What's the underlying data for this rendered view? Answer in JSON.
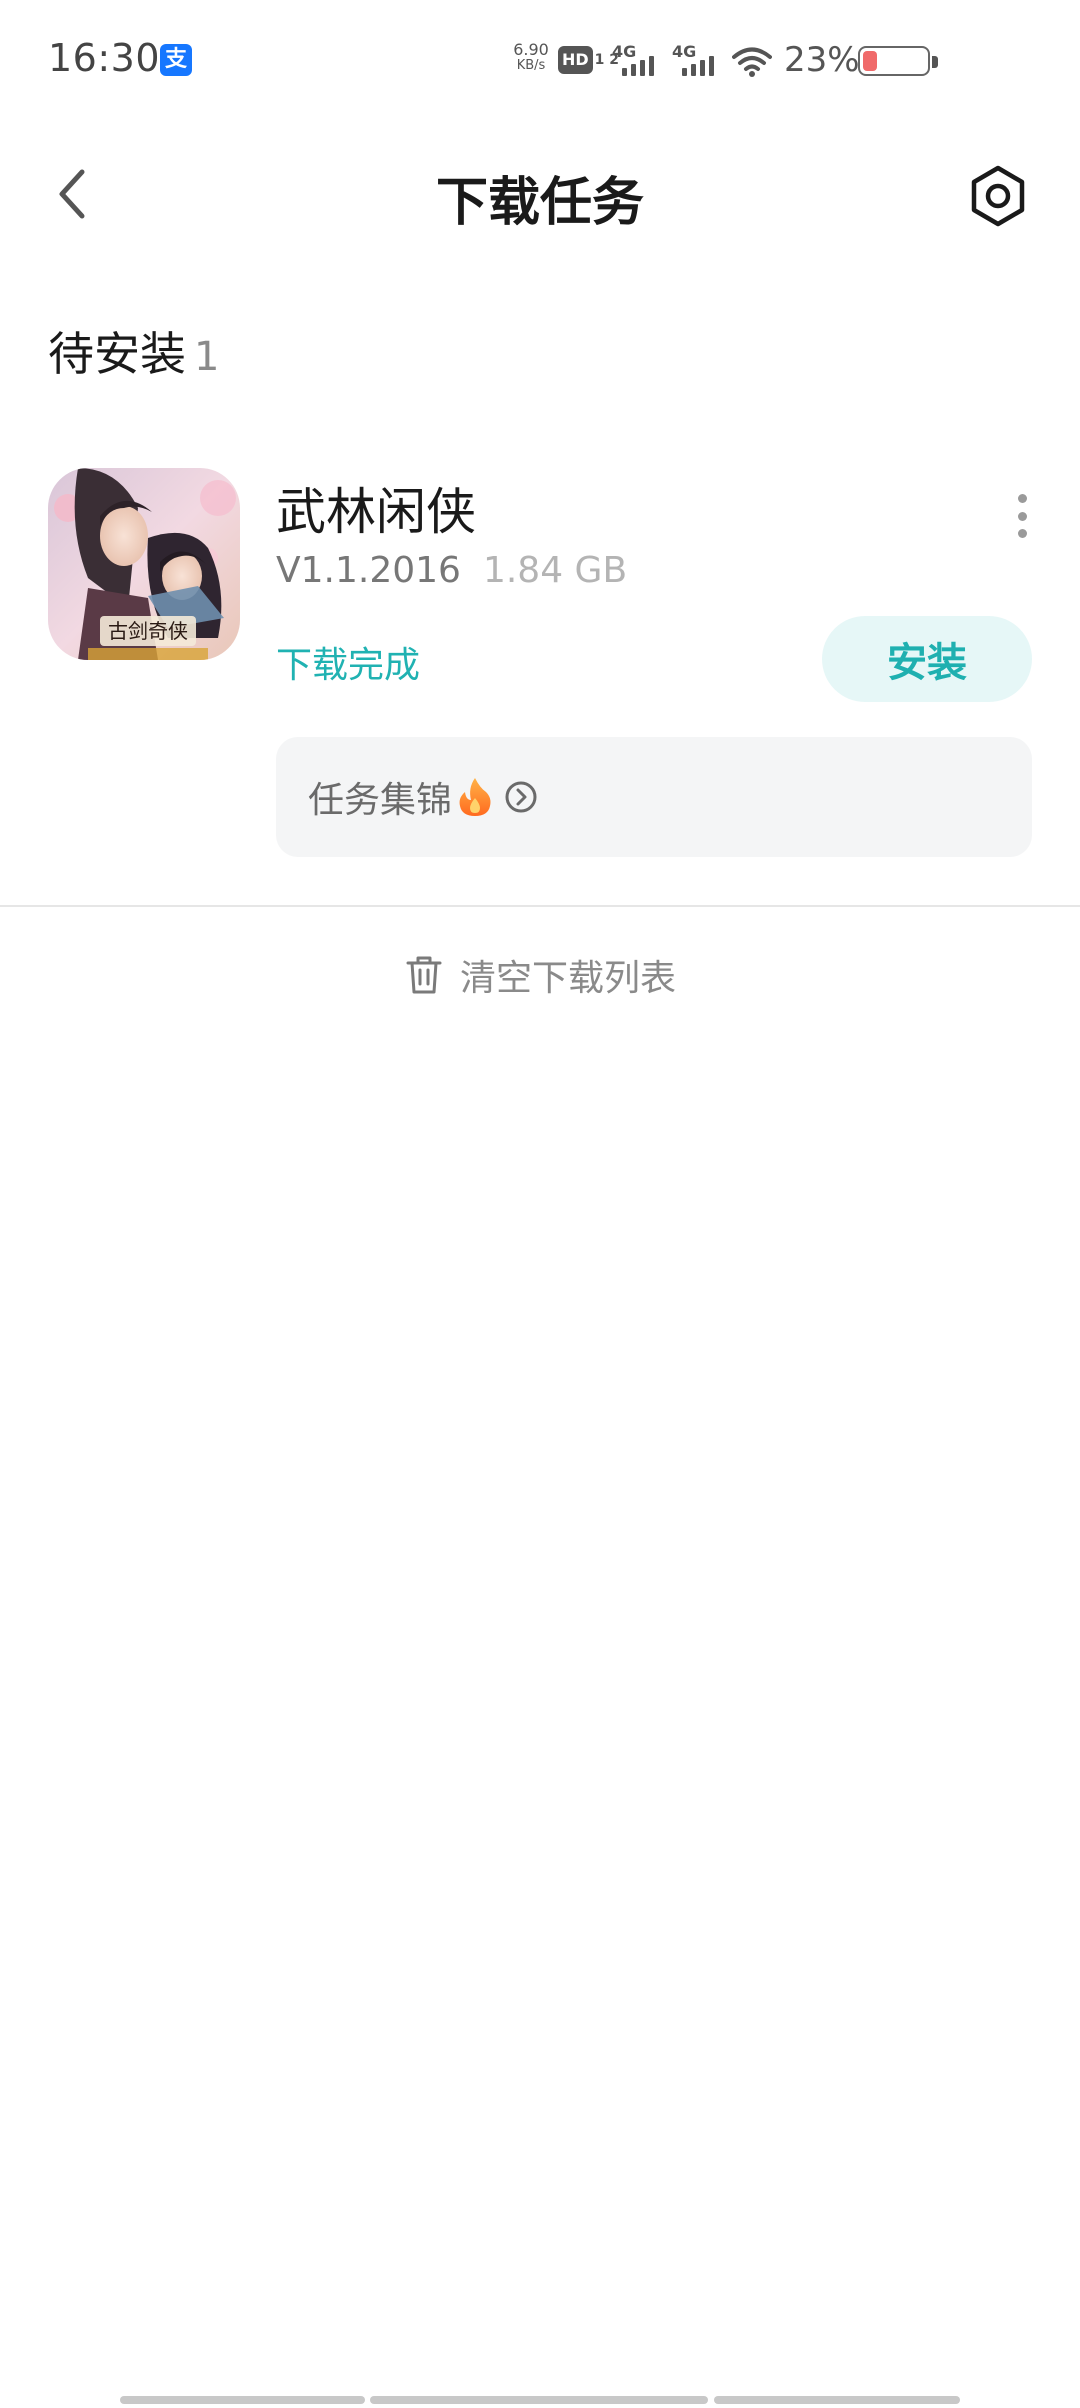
{
  "status_bar": {
    "time": "16:30",
    "alipay_icon_char": "支",
    "net_speed_value": "6.90",
    "net_speed_unit": "KB/s",
    "hd_label": "HD",
    "hd_sims": "1 2",
    "signal_1": "4G",
    "signal_2": "4G",
    "battery_percent": "23%",
    "battery_level": 0.23
  },
  "header": {
    "title": "下载任务",
    "back_icon": "chevron-left-icon",
    "settings_icon": "hexagon-gear-icon"
  },
  "section": {
    "title": "待安装",
    "count": "1"
  },
  "app": {
    "name": "武林闲侠",
    "version": "V1.1.2016",
    "size": "1.84 GB",
    "status": "下载完成",
    "install_label": "安装",
    "highlights_label": "任务集锦",
    "icon_text": "古剑奇侠"
  },
  "actions": {
    "clear_label": "清空下载列表"
  },
  "colors": {
    "accent": "#20b2b2",
    "install_bg": "#e6f7f7",
    "card_bg": "#f4f5f6",
    "battery_low": "#f06a6a"
  }
}
